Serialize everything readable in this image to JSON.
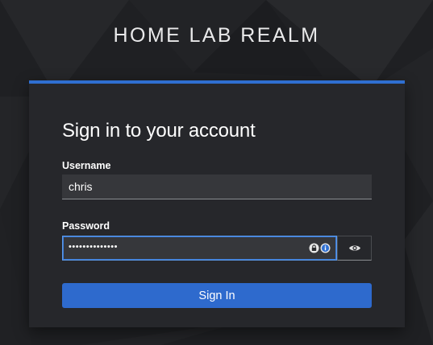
{
  "header": {
    "realm_title": "HOME LAB REALM"
  },
  "login": {
    "heading": "Sign in to your account",
    "username": {
      "label": "Username",
      "value": "chris"
    },
    "password": {
      "label": "Password",
      "masked_value": "••••••••••••••"
    },
    "toggle_icon": "eye-icon",
    "submit_label": "Sign In"
  },
  "colors": {
    "accent": "#2f6fd1",
    "button": "#2e6acd",
    "card": "#26272b",
    "input": "#36373b"
  }
}
